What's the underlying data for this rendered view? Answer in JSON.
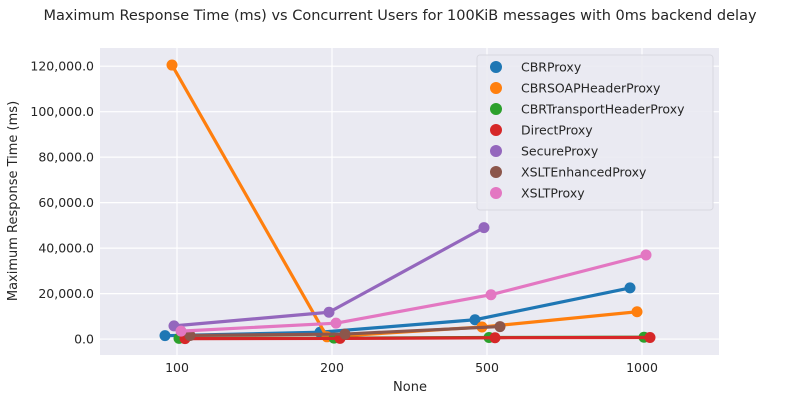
{
  "chart_data": {
    "type": "line",
    "title": "Maximum Response Time (ms) vs Concurrent Users for 100KiB messages with 0ms backend delay",
    "xlabel": "None",
    "ylabel": "Maximum Response Time (ms)",
    "categories": [
      "100",
      "200",
      "500",
      "1000"
    ],
    "y_ticks": [
      0,
      20000,
      40000,
      60000,
      80000,
      100000,
      120000
    ],
    "y_tick_labels": [
      "0.0",
      "20,000.0",
      "40,000.0",
      "60,000.0",
      "80,000.0",
      "100,000.0",
      "120,000.0"
    ],
    "ylim": [
      -7000,
      128000
    ],
    "grid": true,
    "legend_position": "top-right",
    "style": "seaborn-darkgrid",
    "series": [
      {
        "name": "CBRProxy",
        "color": "#1f77b4",
        "values": [
          1500,
          3000,
          8500,
          22500
        ]
      },
      {
        "name": "CBRSOAPHeaderProxy",
        "color": "#ff7f0e",
        "values": [
          120500,
          1000,
          5300,
          12000
        ]
      },
      {
        "name": "CBRTransportHeaderProxy",
        "color": "#2ca02c",
        "values": [
          300,
          400,
          700,
          800
        ]
      },
      {
        "name": "DirectProxy",
        "color": "#d62728",
        "values": [
          200,
          300,
          600,
          700
        ]
      },
      {
        "name": "SecureProxy",
        "color": "#9467bd",
        "values": [
          5800,
          11800,
          49000,
          null
        ]
      },
      {
        "name": "XSLTEnhancedProxy",
        "color": "#8c564b",
        "values": [
          1600,
          2200,
          5500,
          null
        ]
      },
      {
        "name": "XSLTProxy",
        "color": "#e377c2",
        "values": [
          3500,
          7000,
          19500,
          37000
        ]
      }
    ]
  }
}
